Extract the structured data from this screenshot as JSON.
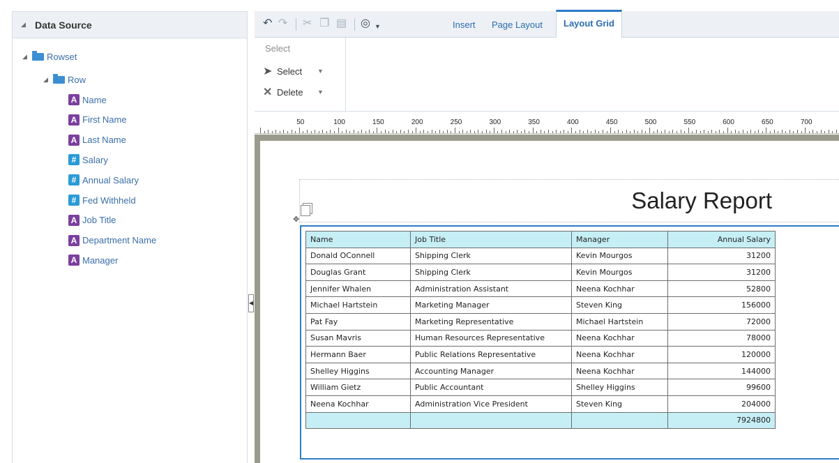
{
  "data_source": {
    "title": "Data Source",
    "rowset_label": "Rowset",
    "row_label": "Row",
    "fields": [
      {
        "label": "Name",
        "type": "text"
      },
      {
        "label": "First Name",
        "type": "text"
      },
      {
        "label": "Last Name",
        "type": "text"
      },
      {
        "label": "Salary",
        "type": "number"
      },
      {
        "label": "Annual Salary",
        "type": "number"
      },
      {
        "label": "Fed Withheld",
        "type": "number"
      },
      {
        "label": "Job Title",
        "type": "text"
      },
      {
        "label": "Department Name",
        "type": "text"
      },
      {
        "label": "Manager",
        "type": "text"
      }
    ]
  },
  "toolbar": {
    "tabs": {
      "insert": "Insert",
      "page_layout": "Page Layout",
      "layout_grid": "Layout Grid"
    },
    "icons": [
      "undo-icon",
      "redo-icon",
      "cut-icon",
      "copy-icon",
      "paste-icon",
      "preview-icon"
    ]
  },
  "ribbon": {
    "group_title": "Select",
    "select_label": "Select",
    "delete_label": "Delete"
  },
  "ruler": {
    "labels": [
      "50",
      "100",
      "150",
      "200",
      "250",
      "300",
      "350",
      "400",
      "450",
      "500",
      "550",
      "600",
      "650",
      "700"
    ]
  },
  "report": {
    "title": "Salary Report",
    "headers": [
      "Name",
      "Job Title",
      "Manager",
      "Annual Salary"
    ],
    "rows": [
      [
        "Donald OConnell",
        "Shipping Clerk",
        "Kevin Mourgos",
        "31200"
      ],
      [
        "Douglas Grant",
        "Shipping Clerk",
        "Kevin Mourgos",
        "31200"
      ],
      [
        "Jennifer Whalen",
        "Administration Assistant",
        "Neena Kochhar",
        "52800"
      ],
      [
        "Michael Hartstein",
        "Marketing Manager",
        "Steven King",
        "156000"
      ],
      [
        "Pat Fay",
        "Marketing Representative",
        "Michael Hartstein",
        "72000"
      ],
      [
        "Susan Mavris",
        "Human Resources Representative",
        "Neena Kochhar",
        "78000"
      ],
      [
        "Hermann Baer",
        "Public Relations Representative",
        "Neena Kochhar",
        "120000"
      ],
      [
        "Shelley Higgins",
        "Accounting Manager",
        "Neena Kochhar",
        "144000"
      ],
      [
        "William Gietz",
        "Public Accountant",
        "Shelley Higgins",
        "99600"
      ],
      [
        "Neena Kochhar",
        "Administration Vice President",
        "Steven King",
        "204000"
      ]
    ],
    "total": "7924800"
  },
  "colors": {
    "accent": "#2c79c8",
    "header_fill": "#c6eef5",
    "text_field_icon": "#7b3f9e",
    "number_field_icon": "#2a9bd6"
  }
}
